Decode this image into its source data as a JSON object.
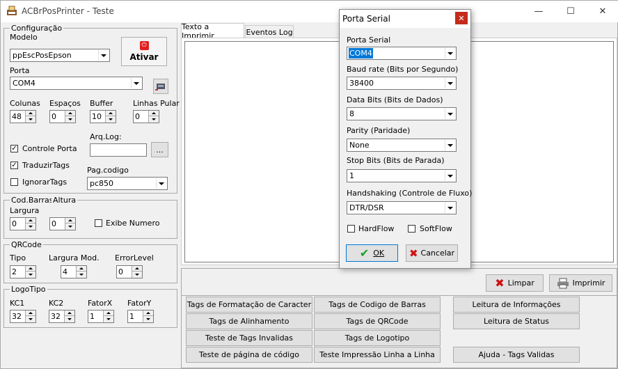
{
  "window": {
    "title": "ACBrPosPrinter - Teste",
    "minimize": "—",
    "maximize": "☐",
    "close": "✕"
  },
  "config": {
    "group_label": "Configuração",
    "modelo_label": "Modelo",
    "modelo_value": "ppEscPosEpson",
    "ativar_label": "Ativar",
    "porta_label": "Porta",
    "porta_value": "COM4",
    "colunas_label": "Colunas",
    "colunas_value": "48",
    "espacos_label": "Espaços",
    "espacos_value": "0",
    "buffer_label": "Buffer",
    "buffer_value": "10",
    "linhas_label": "Linhas Pular",
    "linhas_value": "0",
    "arqlog_label": "Arq.Log:",
    "arqlog_value": "",
    "browse_label": "...",
    "controle_porta_label": "Controle Porta",
    "controle_porta_checked": "✓",
    "traduzir_label": "TraduzirTags",
    "traduzir_checked": "✓",
    "ignorar_label": "IgnorarTags",
    "ignorar_checked": "",
    "pagcod_label": "Pag.codigo",
    "pagcod_value": "pc850"
  },
  "codbarras": {
    "group_label": "Cod.Barras",
    "altura_group": "Altura",
    "largura_label": "Largura",
    "largura_value": "0",
    "altura_value": "0",
    "exibe_label": "Exibe Numero",
    "exibe_checked": ""
  },
  "qrcode": {
    "group_label": "QRCode",
    "tipo_label": "Tipo",
    "tipo_value": "2",
    "largura_label": "Largura Mod.",
    "largura_value": "4",
    "error_label": "ErrorLevel",
    "error_value": "0"
  },
  "logotipo": {
    "group_label": "LogoTipo",
    "kc1_label": "KC1",
    "kc1_value": "32",
    "kc2_label": "KC2",
    "kc2_value": "32",
    "fatorx_label": "FatorX",
    "fatorx_value": "1",
    "fatory_label": "FatorY",
    "fatory_value": "1"
  },
  "tabs": {
    "tab1": "Texto a Imprimir",
    "tab2": "Eventos Log"
  },
  "actions": {
    "limpar": "Limpar",
    "imprimir": "Imprimir"
  },
  "buttons": {
    "b1": "Tags de Formatação de Caracter",
    "b2": "Tags de Codigo de Barras",
    "b3": "Leitura de Informações",
    "b4": "Tags de Alinhamento",
    "b5": "Tags de QRCode",
    "b6": "Leitura de Status",
    "b7": "Teste de Tags Invalidas",
    "b8": "Tags de Logotipo",
    "b9": "Teste de página de código",
    "b10": "Teste Impressão Linha a Linha",
    "b11": "Ajuda - Tags Validas"
  },
  "dialog": {
    "title": "Porta Serial",
    "close": "✕",
    "porta_label": "Porta Serial",
    "porta_value": "COM4",
    "baud_label": "Baud rate (Bits por Segundo)",
    "baud_value": "38400",
    "data_label": "Data Bits (Bits de Dados)",
    "data_value": "8",
    "parity_label": "Parity (Paridade)",
    "parity_value": "None",
    "stop_label": "Stop Bits (Bits de Parada)",
    "stop_value": "1",
    "hand_label": "Handshaking (Controle de Fluxo)",
    "hand_value": "DTR/DSR",
    "hardflow_label": "HardFlow",
    "softflow_label": "SoftFlow",
    "ok_label": "OK",
    "cancel_label": "Cancelar"
  },
  "colors": {
    "accent": "#0078d7",
    "close_red": "#c42b1c",
    "power_red": "#e02020",
    "ok_green": "#1a9e2a",
    "cancel_red": "#d01010"
  }
}
